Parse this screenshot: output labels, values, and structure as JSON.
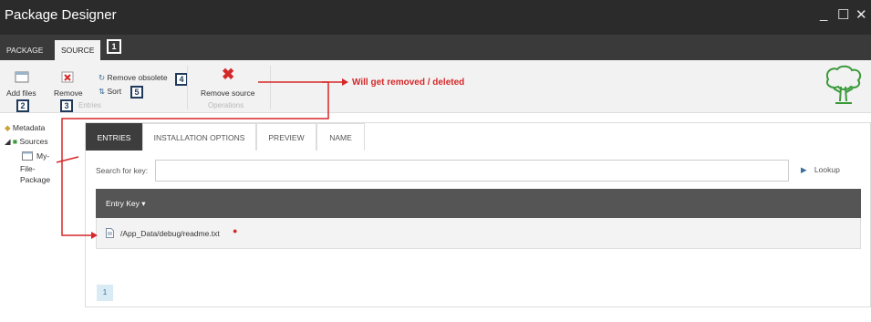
{
  "window": {
    "title": "Package Designer",
    "minimize": "_",
    "maximize": "☐",
    "close": "✕"
  },
  "main_tabs": [
    {
      "label": "PACKAGE"
    },
    {
      "label": "SOURCE"
    }
  ],
  "ribbon": {
    "add_files": "Add files",
    "remove": "Remove",
    "remove_obsolete": "Remove obsolete",
    "sort": "Sort",
    "entries_group": "Entries",
    "remove_source": "Remove source",
    "operations_group": "Operations"
  },
  "callouts": [
    "1",
    "2",
    "3",
    "4",
    "5"
  ],
  "annotation": "Will get removed / deleted",
  "tree": {
    "metadata": "Metadata",
    "sources": "Sources",
    "package_lines": [
      "My-",
      "File-",
      "Package"
    ]
  },
  "sub_tabs": [
    {
      "label": "ENTRIES"
    },
    {
      "label": "INSTALLATION OPTIONS"
    },
    {
      "label": "PREVIEW"
    },
    {
      "label": "NAME"
    }
  ],
  "search": {
    "label": "Search for key:",
    "value": ""
  },
  "lookup": "Lookup",
  "grid": {
    "header": "Entry Key",
    "rows": [
      {
        "key": "/App_Data/debug/readme.txt"
      }
    ]
  },
  "pager": {
    "page": "1"
  },
  "colors": {
    "titlebar": "#2b2b2b",
    "accent_red": "#d62728",
    "callout": "#1f3a5a",
    "tree_green": "#3a9a3a"
  }
}
